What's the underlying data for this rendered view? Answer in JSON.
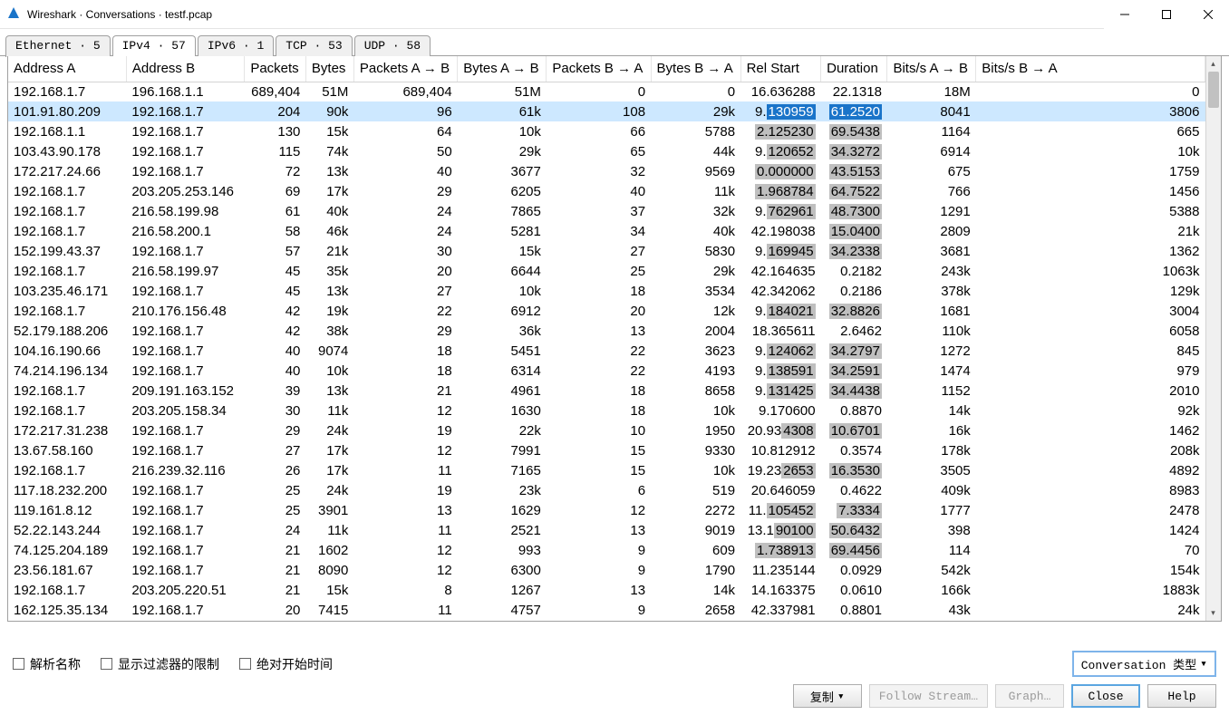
{
  "window": {
    "title": "Wireshark · Conversations · testf.pcap"
  },
  "tabs": [
    {
      "label": "Ethernet · 5",
      "active": false
    },
    {
      "label": "IPv4 · 57",
      "active": true
    },
    {
      "label": "IPv6 · 1",
      "active": false
    },
    {
      "label": "TCP · 53",
      "active": false
    },
    {
      "label": "UDP · 58",
      "active": false
    }
  ],
  "columns": [
    "Address A",
    "Address B",
    "Packets",
    "Bytes",
    "Packets A → B",
    "Bytes A → B",
    "Packets B → A",
    "Bytes B → A",
    "Rel Start",
    "Duration",
    "Bits/s A → B",
    "Bits/s B → A"
  ],
  "rows": [
    {
      "a": "192.168.1.7",
      "b": "196.168.1.1",
      "pk": "689,404",
      "by": "51M",
      "pab": "689,404",
      "bab": "51M",
      "pba": "0",
      "bba": "0",
      "rs": "16.636288",
      "du": "22.1318",
      "bsab": "18M",
      "bsba": "0",
      "sel": false
    },
    {
      "a": "101.91.80.209",
      "b": "192.168.1.7",
      "pk": "204",
      "by": "90k",
      "pab": "96",
      "bab": "61k",
      "pba": "108",
      "bba": "29k",
      "rs": "9.130959",
      "du": "61.2520",
      "bsab": "8041",
      "bsba": "3806",
      "sel": true,
      "rshl": "130959",
      "duhl": "61.2520",
      "rspre": "9."
    },
    {
      "a": "192.168.1.1",
      "b": "192.168.1.7",
      "pk": "130",
      "by": "15k",
      "pab": "64",
      "bab": "10k",
      "pba": "66",
      "bba": "5788",
      "rs": "2.125230",
      "du": "69.5438",
      "bsab": "1164",
      "bsba": "665",
      "sel": false,
      "rsgray": "2.125230",
      "dugray": "69.5438"
    },
    {
      "a": "103.43.90.178",
      "b": "192.168.1.7",
      "pk": "115",
      "by": "74k",
      "pab": "50",
      "bab": "29k",
      "pba": "65",
      "bba": "44k",
      "rs": "9.120652",
      "du": "34.3272",
      "bsab": "6914",
      "bsba": "10k",
      "sel": false,
      "rspre": "9.",
      "rsgray": "120652",
      "dugray": "34.3272"
    },
    {
      "a": "172.217.24.66",
      "b": "192.168.1.7",
      "pk": "72",
      "by": "13k",
      "pab": "40",
      "bab": "3677",
      "pba": "32",
      "bba": "9569",
      "rs": "0.000000",
      "du": "43.5153",
      "bsab": "675",
      "bsba": "1759",
      "sel": false,
      "rsgray": "0.000000",
      "dugray": "43.5153"
    },
    {
      "a": "192.168.1.7",
      "b": "203.205.253.146",
      "pk": "69",
      "by": "17k",
      "pab": "29",
      "bab": "6205",
      "pba": "40",
      "bba": "11k",
      "rs": "1.968784",
      "du": "64.7522",
      "bsab": "766",
      "bsba": "1456",
      "sel": false,
      "rsgray": "1.968784",
      "dugray": "64.7522"
    },
    {
      "a": "192.168.1.7",
      "b": "216.58.199.98",
      "pk": "61",
      "by": "40k",
      "pab": "24",
      "bab": "7865",
      "pba": "37",
      "bba": "32k",
      "rs": "9.762961",
      "du": "48.7300",
      "bsab": "1291",
      "bsba": "5388",
      "sel": false,
      "rspre": "9.",
      "rsgray": "762961",
      "dugray": "48.7300"
    },
    {
      "a": "192.168.1.7",
      "b": "216.58.200.1",
      "pk": "58",
      "by": "46k",
      "pab": "24",
      "bab": "5281",
      "pba": "34",
      "bba": "40k",
      "rs": "42.198038",
      "du": "15.0400",
      "bsab": "2809",
      "bsba": "21k",
      "sel": false,
      "rspre": "42.198038",
      "dugray": "15.0400"
    },
    {
      "a": "152.199.43.37",
      "b": "192.168.1.7",
      "pk": "57",
      "by": "21k",
      "pab": "30",
      "bab": "15k",
      "pba": "27",
      "bba": "5830",
      "rs": "9.169945",
      "du": "34.2338",
      "bsab": "3681",
      "bsba": "1362",
      "sel": false,
      "rspre": "9.",
      "rsgray": "169945",
      "dugray": "34.2338"
    },
    {
      "a": "192.168.1.7",
      "b": "216.58.199.97",
      "pk": "45",
      "by": "35k",
      "pab": "20",
      "bab": "6644",
      "pba": "25",
      "bba": "29k",
      "rs": "42.164635",
      "du": "0.2182",
      "bsab": "243k",
      "bsba": "1063k",
      "sel": false
    },
    {
      "a": "103.235.46.171",
      "b": "192.168.1.7",
      "pk": "45",
      "by": "13k",
      "pab": "27",
      "bab": "10k",
      "pba": "18",
      "bba": "3534",
      "rs": "42.342062",
      "du": "0.2186",
      "bsab": "378k",
      "bsba": "129k",
      "sel": false
    },
    {
      "a": "192.168.1.7",
      "b": "210.176.156.48",
      "pk": "42",
      "by": "19k",
      "pab": "22",
      "bab": "6912",
      "pba": "20",
      "bba": "12k",
      "rs": "9.184021",
      "du": "32.8826",
      "bsab": "1681",
      "bsba": "3004",
      "sel": false,
      "rspre": "9.",
      "rsgray": "184021",
      "dugray": "32.8826"
    },
    {
      "a": "52.179.188.206",
      "b": "192.168.1.7",
      "pk": "42",
      "by": "38k",
      "pab": "29",
      "bab": "36k",
      "pba": "13",
      "bba": "2004",
      "rs": "18.365611",
      "du": "2.6462",
      "bsab": "110k",
      "bsba": "6058",
      "sel": false
    },
    {
      "a": "104.16.190.66",
      "b": "192.168.1.7",
      "pk": "40",
      "by": "9074",
      "pab": "18",
      "bab": "5451",
      "pba": "22",
      "bba": "3623",
      "rs": "9.124062",
      "du": "34.2797",
      "bsab": "1272",
      "bsba": "845",
      "sel": false,
      "rspre": "9.",
      "rsgray": "124062",
      "dugray": "34.2797"
    },
    {
      "a": "74.214.196.134",
      "b": "192.168.1.7",
      "pk": "40",
      "by": "10k",
      "pab": "18",
      "bab": "6314",
      "pba": "22",
      "bba": "4193",
      "rs": "9.138591",
      "du": "34.2591",
      "bsab": "1474",
      "bsba": "979",
      "sel": false,
      "rspre": "9.",
      "rsgray": "138591",
      "dugray": "34.2591"
    },
    {
      "a": "192.168.1.7",
      "b": "209.191.163.152",
      "pk": "39",
      "by": "13k",
      "pab": "21",
      "bab": "4961",
      "pba": "18",
      "bba": "8658",
      "rs": "9.131425",
      "du": "34.4438",
      "bsab": "1152",
      "bsba": "2010",
      "sel": false,
      "rspre": "9.",
      "rsgray": "131425",
      "dugray": "34.4438"
    },
    {
      "a": "192.168.1.7",
      "b": "203.205.158.34",
      "pk": "30",
      "by": "11k",
      "pab": "12",
      "bab": "1630",
      "pba": "18",
      "bba": "10k",
      "rs": "9.170600",
      "du": "0.8870",
      "bsab": "14k",
      "bsba": "92k",
      "sel": false
    },
    {
      "a": "172.217.31.238",
      "b": "192.168.1.7",
      "pk": "29",
      "by": "24k",
      "pab": "19",
      "bab": "22k",
      "pba": "10",
      "bba": "1950",
      "rs": "20.934308",
      "du": "10.6701",
      "bsab": "16k",
      "bsba": "1462",
      "sel": false,
      "rspre": "20.93",
      "rsgray": "4308",
      "dugray": "10.6701"
    },
    {
      "a": "13.67.58.160",
      "b": "192.168.1.7",
      "pk": "27",
      "by": "17k",
      "pab": "12",
      "bab": "7991",
      "pba": "15",
      "bba": "9330",
      "rs": "10.812912",
      "du": "0.3574",
      "bsab": "178k",
      "bsba": "208k",
      "sel": false
    },
    {
      "a": "192.168.1.7",
      "b": "216.239.32.116",
      "pk": "26",
      "by": "17k",
      "pab": "11",
      "bab": "7165",
      "pba": "15",
      "bba": "10k",
      "rs": "19.232653",
      "du": "16.3530",
      "bsab": "3505",
      "bsba": "4892",
      "sel": false,
      "rspre": "19.23",
      "rsgray": "2653",
      "dugray": "16.3530"
    },
    {
      "a": "117.18.232.200",
      "b": "192.168.1.7",
      "pk": "25",
      "by": "24k",
      "pab": "19",
      "bab": "23k",
      "pba": "6",
      "bba": "519",
      "rs": "20.646059",
      "du": "0.4622",
      "bsab": "409k",
      "bsba": "8983",
      "sel": false
    },
    {
      "a": "119.161.8.12",
      "b": "192.168.1.7",
      "pk": "25",
      "by": "3901",
      "pab": "13",
      "bab": "1629",
      "pba": "12",
      "bba": "2272",
      "rs": "11.105452",
      "du": "7.3334",
      "bsab": "1777",
      "bsba": "2478",
      "sel": false,
      "rspre": "11.",
      "rsgray": "105452",
      "dugray": "7.3334"
    },
    {
      "a": "52.22.143.244",
      "b": "192.168.1.7",
      "pk": "24",
      "by": "11k",
      "pab": "11",
      "bab": "2521",
      "pba": "13",
      "bba": "9019",
      "rs": "13.190100",
      "du": "50.6432",
      "bsab": "398",
      "bsba": "1424",
      "sel": false,
      "rspre": "13.1",
      "rsgray": "90100",
      "dugray": "50.6432"
    },
    {
      "a": "74.125.204.189",
      "b": "192.168.1.7",
      "pk": "21",
      "by": "1602",
      "pab": "12",
      "bab": "993",
      "pba": "9",
      "bba": "609",
      "rs": "1.738913",
      "du": "69.4456",
      "bsab": "114",
      "bsba": "70",
      "sel": false,
      "rsgray": "1.738913",
      "dugray": "69.4456"
    },
    {
      "a": "23.56.181.67",
      "b": "192.168.1.7",
      "pk": "21",
      "by": "8090",
      "pab": "12",
      "bab": "6300",
      "pba": "9",
      "bba": "1790",
      "rs": "11.235144",
      "du": "0.0929",
      "bsab": "542k",
      "bsba": "154k",
      "sel": false
    },
    {
      "a": "192.168.1.7",
      "b": "203.205.220.51",
      "pk": "21",
      "by": "15k",
      "pab": "8",
      "bab": "1267",
      "pba": "13",
      "bba": "14k",
      "rs": "14.163375",
      "du": "0.0610",
      "bsab": "166k",
      "bsba": "1883k",
      "sel": false
    },
    {
      "a": "162.125.35.134",
      "b": "192.168.1.7",
      "pk": "20",
      "by": "7415",
      "pab": "11",
      "bab": "4757",
      "pba": "9",
      "bba": "2658",
      "rs": "42.337981",
      "du": "0.8801",
      "bsab": "43k",
      "bsba": "24k",
      "sel": false
    }
  ],
  "footer": {
    "resolve": "解析名称",
    "limit": "显示过滤器的限制",
    "abs": "绝对开始时间",
    "convType": "Conversation 类型"
  },
  "buttons": {
    "copy": "复制",
    "follow": "Follow Stream…",
    "graph": "Graph…",
    "close": "Close",
    "help": "Help"
  }
}
